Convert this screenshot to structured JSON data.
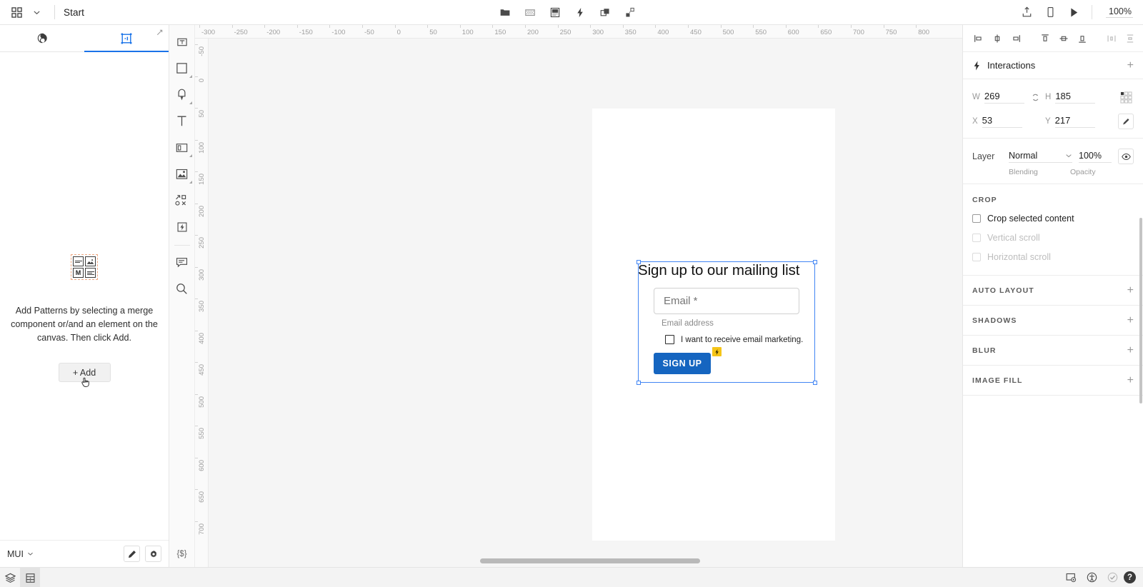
{
  "topbar": {
    "apps_icon": "grid-apps-icon",
    "chevron_icon": "chevron-down-icon",
    "title": "Start",
    "center_tools": [
      {
        "name": "folder-icon",
        "label": "Folder"
      },
      {
        "name": "pattern-grid-icon",
        "label": "Patterns"
      },
      {
        "name": "component-icon",
        "label": "Component"
      },
      {
        "name": "lightning-icon",
        "label": "Interactions"
      },
      {
        "name": "duplicate-icon",
        "label": "Duplicate"
      },
      {
        "name": "variants-icon",
        "label": "Variants"
      }
    ],
    "right_tools": [
      {
        "name": "export-icon",
        "label": "Export"
      },
      {
        "name": "device-preview-icon",
        "label": "Preview device"
      },
      {
        "name": "play-icon",
        "label": "Play"
      }
    ],
    "zoom": "100%"
  },
  "left_panel": {
    "tabs": [
      {
        "name": "merge-components-tab",
        "icon": "merge-icon",
        "active": false
      },
      {
        "name": "patterns-tab",
        "icon": "patterns-icon",
        "active": true
      }
    ],
    "expand_icon": "expand-diagonal-icon",
    "empty_state": {
      "icon": "patterns-placeholder-icon",
      "letter": "M",
      "message": "Add Patterns by selecting a merge component or/and an element on the canvas. Then click Add.",
      "add_button": "+ Add"
    },
    "footer": {
      "library": "MUI",
      "library_chevron": "chevron-down-icon",
      "edit_icon": "pencil-icon",
      "settings_icon": "gear-icon"
    }
  },
  "tool_rail": {
    "tools": [
      {
        "name": "frame-tool",
        "icon": "frame-icon",
        "caret": false
      },
      {
        "name": "rectangle-tool",
        "icon": "rectangle-icon",
        "caret": true
      },
      {
        "name": "pen-tool",
        "icon": "pen-icon",
        "caret": true
      },
      {
        "name": "text-tool",
        "icon": "text-icon",
        "caret": false
      },
      {
        "name": "container-tool",
        "icon": "container-icon",
        "caret": true
      },
      {
        "name": "image-tool",
        "icon": "image-icon",
        "caret": true
      },
      {
        "name": "vector-tool",
        "icon": "vector-nodes-icon",
        "caret": false
      },
      {
        "name": "interaction-tool",
        "icon": "lightning-box-icon",
        "caret": false
      },
      {
        "name": "comment-tool",
        "icon": "comment-icon",
        "caret": false
      },
      {
        "name": "zoom-tool",
        "icon": "magnifier-icon",
        "caret": false
      }
    ],
    "code_tool": "{$}"
  },
  "canvas": {
    "ruler_h": [
      "-300",
      "-250",
      "-200",
      "-150",
      "-100",
      "-50",
      "0",
      "50",
      "100",
      "150",
      "200",
      "250",
      "300",
      "350",
      "400",
      "450",
      "500",
      "550",
      "600",
      "650",
      "700",
      "750",
      "800"
    ],
    "ruler_v": [
      "-50",
      "0",
      "50",
      "100",
      "150",
      "200",
      "250",
      "300",
      "350",
      "400",
      "450",
      "500",
      "550",
      "600",
      "650",
      "700"
    ],
    "form": {
      "title": "Sign up to our mailing list",
      "email_placeholder": "Email *",
      "email_helper": "Email address",
      "checkbox_label": "I want to receive email marketing.",
      "submit_label": "SIGN UP",
      "badge_icon": "lightning-badge-icon",
      "accent_color": "#1565c0",
      "badge_color": "#f5c518"
    },
    "selection": {
      "border_color": "#4285f4",
      "handles": [
        "top-left",
        "top-right",
        "bottom-left",
        "bottom-right"
      ]
    }
  },
  "right_panel": {
    "align_tools": [
      {
        "name": "align-left-icon"
      },
      {
        "name": "align-center-horizontal-icon"
      },
      {
        "name": "align-right-icon"
      },
      {
        "name": "align-top-icon"
      },
      {
        "name": "align-middle-vertical-icon"
      },
      {
        "name": "align-bottom-icon"
      },
      {
        "name": "distribute-horizontal-icon"
      },
      {
        "name": "distribute-vertical-icon"
      },
      {
        "name": "grid-layout-icon"
      }
    ],
    "interactions": {
      "icon": "lightning-icon",
      "title": "Interactions",
      "add": "+"
    },
    "dimensions": {
      "w_label": "W",
      "w_value": "269",
      "h_label": "H",
      "h_value": "185",
      "x_label": "X",
      "x_value": "53",
      "y_label": "Y",
      "y_value": "217",
      "link_icon": "link-ratio-icon",
      "corners_icon": "corner-grid-icon",
      "rotate_icon": "rotate-icon"
    },
    "layer": {
      "label": "Layer",
      "blending": "Normal",
      "blending_sub": "Blending",
      "opacity": "100%",
      "opacity_sub": "Opacity",
      "chevron_icon": "chevron-down-icon",
      "eye_icon": "eye-icon"
    },
    "crop": {
      "title": "CROP",
      "options": [
        {
          "label": "Crop selected content",
          "enabled": true,
          "checked": false
        },
        {
          "label": "Vertical scroll",
          "enabled": false,
          "checked": false
        },
        {
          "label": "Horizontal scroll",
          "enabled": false,
          "checked": false
        }
      ]
    },
    "sections": [
      {
        "title": "AUTO LAYOUT",
        "add": "+"
      },
      {
        "title": "SHADOWS",
        "add": "+"
      },
      {
        "title": "BLUR",
        "add": "+"
      },
      {
        "title": "IMAGE FILL",
        "add": "+"
      }
    ]
  },
  "bottombar": {
    "left": [
      {
        "name": "layers-icon",
        "active": false
      },
      {
        "name": "components-icon",
        "active": true
      }
    ],
    "right": [
      {
        "name": "frame-settings-icon"
      },
      {
        "name": "accessibility-icon"
      },
      {
        "name": "check-circle-icon"
      }
    ],
    "help": "?"
  }
}
